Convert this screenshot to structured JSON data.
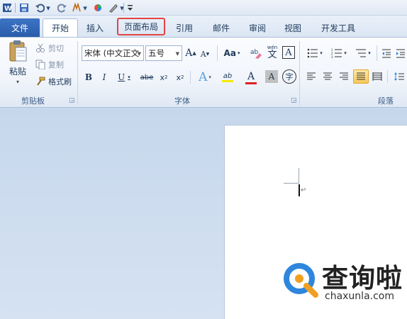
{
  "quick_access": {
    "items": [
      "save-icon",
      "undo-icon",
      "redo-icon",
      "format-icon",
      "color-icon",
      "draw-icon",
      "customize-icon"
    ],
    "dropdown_glyph": "▾"
  },
  "tabs": [
    {
      "label": "文件",
      "state": "file"
    },
    {
      "label": "开始",
      "state": "active"
    },
    {
      "label": "插入",
      "state": "normal"
    },
    {
      "label": "页面布局",
      "state": "highlighted"
    },
    {
      "label": "引用",
      "state": "normal"
    },
    {
      "label": "邮件",
      "state": "normal"
    },
    {
      "label": "审阅",
      "state": "normal"
    },
    {
      "label": "视图",
      "state": "normal"
    },
    {
      "label": "开发工具",
      "state": "normal"
    }
  ],
  "clipboard": {
    "paste_label": "粘贴",
    "cut_label": "剪切",
    "copy_label": "复制",
    "format_painter_label": "格式刷",
    "group_label": "剪贴板"
  },
  "font": {
    "font_name": "宋体 (中文正文",
    "font_size": "五号",
    "grow_glyph": "A",
    "shrink_glyph": "A",
    "case_glyph": "Aa",
    "pinyin_glyph": "wén",
    "pinyin_char": "文",
    "bold": "B",
    "italic": "I",
    "underline": "U",
    "strike": "abe",
    "subscript": "x",
    "sub_mark": "2",
    "superscript": "x",
    "sup_mark": "2",
    "effect_glyph": "A",
    "highlight_glyph": "ab",
    "font_color_glyph": "A",
    "char_shading_glyph": "A",
    "enclose_glyph": "字",
    "border_glyph": "A",
    "group_label": "字体"
  },
  "paragraph": {
    "group_label": "段落"
  },
  "watermark": {
    "brand": "查询啦",
    "url": "chaxunla.com"
  },
  "colors": {
    "file_tab": "#2a5cab",
    "highlight_border": "#e24444",
    "font_color_bar": "#e02020",
    "highlight_bar": "#f7e900",
    "logo_blue": "#2e86de",
    "logo_orange": "#f0a020"
  }
}
